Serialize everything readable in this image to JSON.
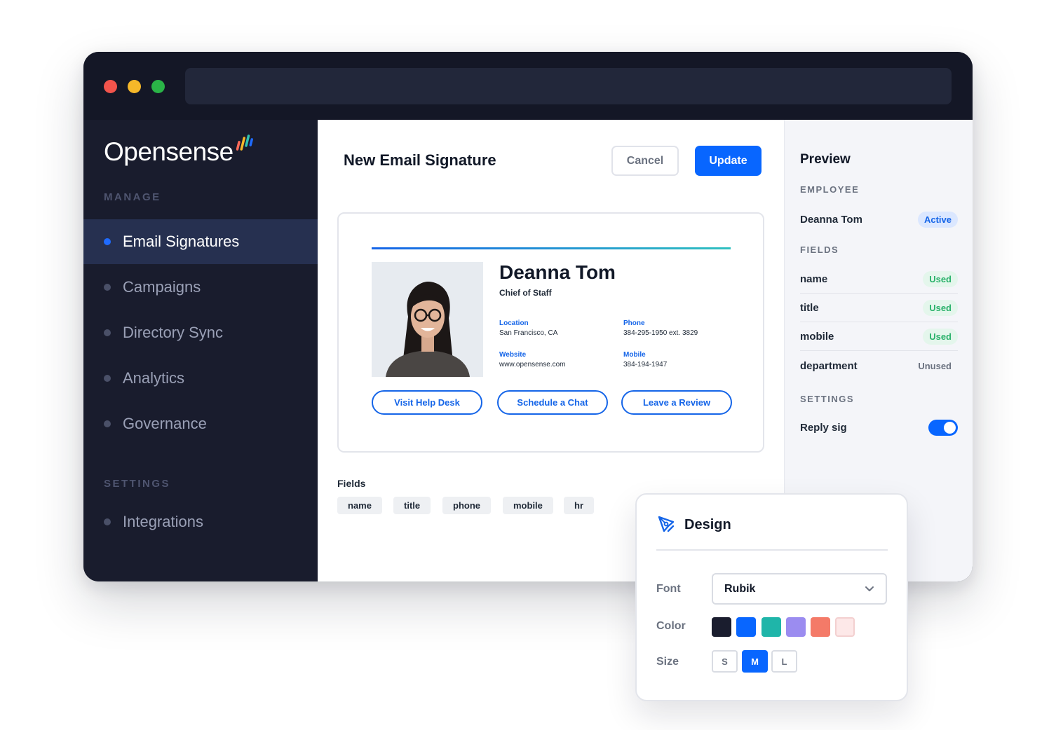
{
  "brand": {
    "name": "Opensense"
  },
  "sidebar": {
    "manage_label": "MANAGE",
    "settings_label": "SETTINGS",
    "items": [
      {
        "label": "Email Signatures",
        "active": true
      },
      {
        "label": "Campaigns"
      },
      {
        "label": "Directory Sync"
      },
      {
        "label": "Analytics"
      },
      {
        "label": "Governance"
      }
    ],
    "settings_items": [
      {
        "label": "Integrations"
      }
    ]
  },
  "editor": {
    "title": "New Email Signature",
    "cancel_label": "Cancel",
    "update_label": "Update",
    "signature": {
      "name": "Deanna Tom",
      "title": "Chief of Staff",
      "location_label": "Location",
      "location": "San Francisco, CA",
      "phone_label": "Phone",
      "phone": "384-295-1950 ext. 3829",
      "website_label": "Website",
      "website": "www.opensense.com",
      "mobile_label": "Mobile",
      "mobile": "384-194-1947",
      "buttons": [
        "Visit Help Desk",
        "Schedule a Chat",
        "Leave a Review"
      ]
    },
    "fields_label": "Fields",
    "fields": [
      "name",
      "title",
      "phone",
      "mobile",
      "hr"
    ]
  },
  "preview": {
    "title": "Preview",
    "employee_label": "EMPLOYEE",
    "employee_name": "Deanna Tom",
    "employee_status": "Active",
    "fields_label": "FIELDS",
    "fields": [
      {
        "name": "name",
        "status": "Used"
      },
      {
        "name": "title",
        "status": "Used"
      },
      {
        "name": "mobile",
        "status": "Used"
      },
      {
        "name": "department",
        "status": "Unused"
      }
    ],
    "settings_label": "SETTINGS",
    "reply_sig_label": "Reply sig",
    "reply_sig_on": true
  },
  "design": {
    "title": "Design",
    "font_label": "Font",
    "font_value": "Rubik",
    "color_label": "Color",
    "colors": [
      "#1a1d2e",
      "#0866ff",
      "#1fb5a9",
      "#9b8cf0",
      "#f47a68",
      "#fde8e8"
    ],
    "size_label": "Size",
    "sizes": [
      "S",
      "M",
      "L"
    ],
    "selected_size": "M"
  },
  "colors": {
    "accent": "#0866ff",
    "sidebar_bg": "#191c2d",
    "used_green": "#2bb26b"
  }
}
